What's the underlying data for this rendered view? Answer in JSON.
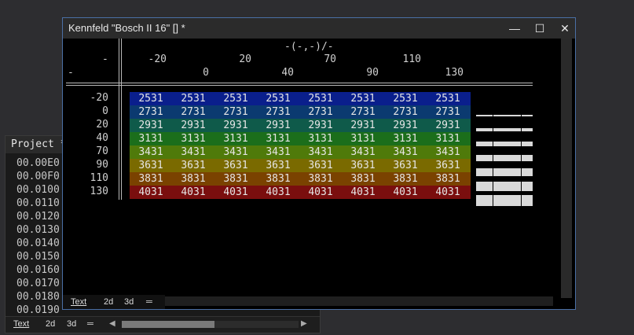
{
  "project": {
    "title": "Project *",
    "lines": [
      "00.00E0",
      "00.00F0",
      "00.0100",
      "00.0110",
      "00.0120",
      "00.0130",
      "00.0140",
      "00.0150",
      "00.0160",
      "00.0170",
      "00.0180",
      "00.0190"
    ],
    "tabs": [
      "Text",
      "2d",
      "3d",
      "═"
    ]
  },
  "kennfeld": {
    "title": "Kennfeld \"Bosch II 16\" [] *",
    "controls": {
      "minimize": "—",
      "maximize": "☐",
      "close": "✕"
    },
    "unit": "-(-,-)/-",
    "corner_top": "-",
    "corner_bottom": "-",
    "x_axis_top": [
      "-20",
      "20",
      "70",
      "110"
    ],
    "x_axis_bottom": [
      "0",
      "40",
      "90",
      "130"
    ],
    "y_axis": [
      "-20",
      "0",
      "20",
      "40",
      "70",
      "90",
      "110",
      "130"
    ],
    "rows": [
      [
        "2531",
        "2531",
        "2531",
        "2531",
        "2531",
        "2531",
        "2531",
        "2531"
      ],
      [
        "2731",
        "2731",
        "2731",
        "2731",
        "2731",
        "2731",
        "2731",
        "2731"
      ],
      [
        "2931",
        "2931",
        "2931",
        "2931",
        "2931",
        "2931",
        "2931",
        "2931"
      ],
      [
        "3131",
        "3131",
        "3131",
        "3131",
        "3131",
        "3131",
        "3131",
        "3131"
      ],
      [
        "3431",
        "3431",
        "3431",
        "3431",
        "3431",
        "3431",
        "3431",
        "3431"
      ],
      [
        "3631",
        "3631",
        "3631",
        "3631",
        "3631",
        "3631",
        "3631",
        "3631"
      ],
      [
        "3831",
        "3831",
        "3831",
        "3831",
        "3831",
        "3831",
        "3831",
        "3831"
      ],
      [
        "4031",
        "4031",
        "4031",
        "4031",
        "4031",
        "4031",
        "4031",
        "4031"
      ]
    ],
    "row_colors": [
      "#0a1f8c",
      "#0b3a70",
      "#0f5a4a",
      "#1b6e1b",
      "#4f7a0a",
      "#7a6a00",
      "#7a4200",
      "#7a0e0e"
    ],
    "tabs": [
      "Text",
      "2d",
      "3d",
      "═"
    ]
  }
}
